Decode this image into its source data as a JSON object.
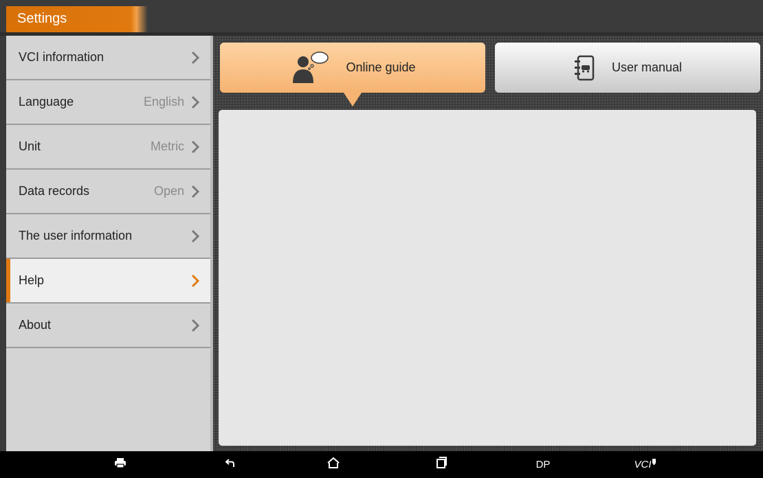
{
  "header": {
    "title": "Settings"
  },
  "sidebar": {
    "items": [
      {
        "label": "VCI information",
        "value": ""
      },
      {
        "label": "Language",
        "value": "English"
      },
      {
        "label": "Unit",
        "value": "Metric"
      },
      {
        "label": "Data records",
        "value": "Open"
      },
      {
        "label": "The user information",
        "value": ""
      },
      {
        "label": "Help",
        "value": "",
        "active": true
      },
      {
        "label": "About",
        "value": ""
      }
    ]
  },
  "main": {
    "tabs": [
      {
        "label": "Online guide",
        "selected": true,
        "icon": "user-chat-icon"
      },
      {
        "label": "User manual",
        "selected": false,
        "icon": "manual-book-icon"
      }
    ]
  },
  "navbar": {
    "items": [
      {
        "icon": "print-icon"
      },
      {
        "icon": "back-icon"
      },
      {
        "icon": "home-icon"
      },
      {
        "icon": "recent-apps-icon"
      },
      {
        "label": "DP"
      },
      {
        "label": "VCI"
      }
    ]
  },
  "colors": {
    "accent": "#e07a10",
    "chevron": "#7a7a7a",
    "background": "#3b3b3b"
  }
}
